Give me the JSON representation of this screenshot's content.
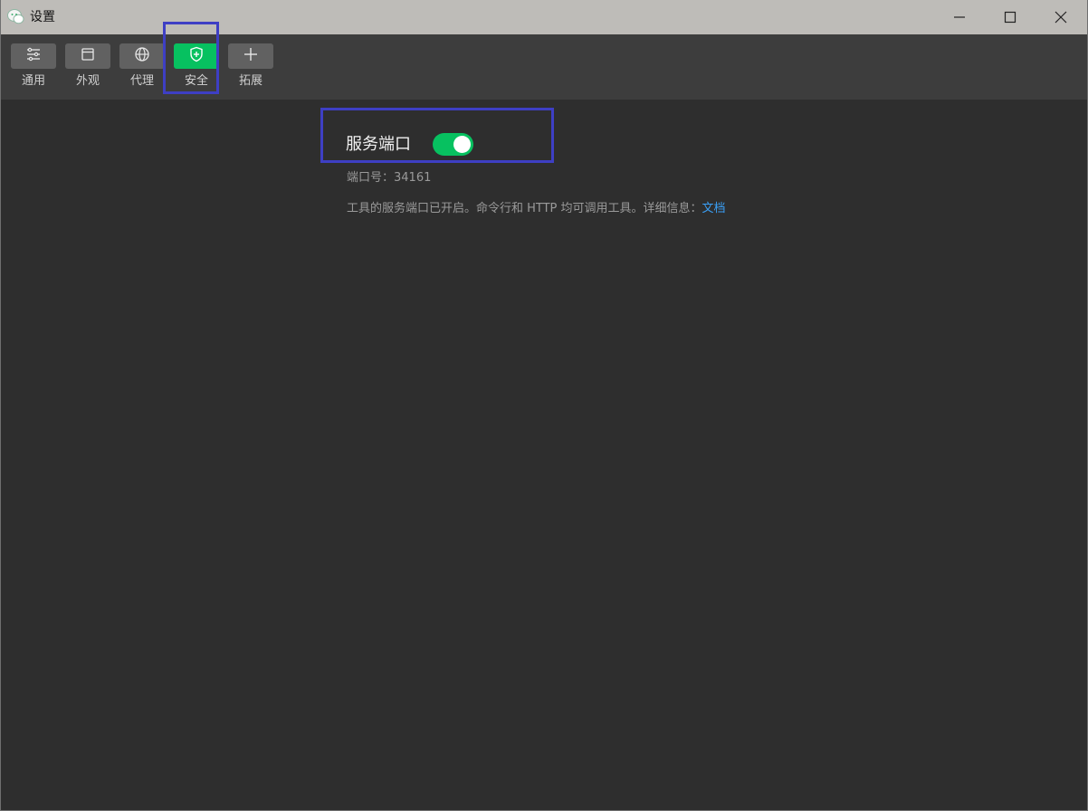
{
  "window": {
    "title": "设置"
  },
  "toolbar": {
    "items": [
      {
        "label": "通用",
        "icon": "sliders-icon",
        "active": false
      },
      {
        "label": "外观",
        "icon": "window-icon",
        "active": false
      },
      {
        "label": "代理",
        "icon": "globe-icon",
        "active": false
      },
      {
        "label": "安全",
        "icon": "shield-icon",
        "active": true
      },
      {
        "label": "拓展",
        "icon": "plus-icon",
        "active": false
      }
    ]
  },
  "security": {
    "service_port_title": "服务端口",
    "service_port_enabled": true,
    "port_label": "端口号：",
    "port_value": "34161",
    "description": "工具的服务端口已开启。命令行和 HTTP 均可调用工具。详细信息：",
    "doc_link": "文档"
  },
  "colors": {
    "accent": "#07c160",
    "link": "#3a9ff5",
    "highlight": "#3e3fc4",
    "background": "#2e2e2e",
    "toolbar": "#3d3d3d",
    "titlebar": "#bebcb8"
  }
}
